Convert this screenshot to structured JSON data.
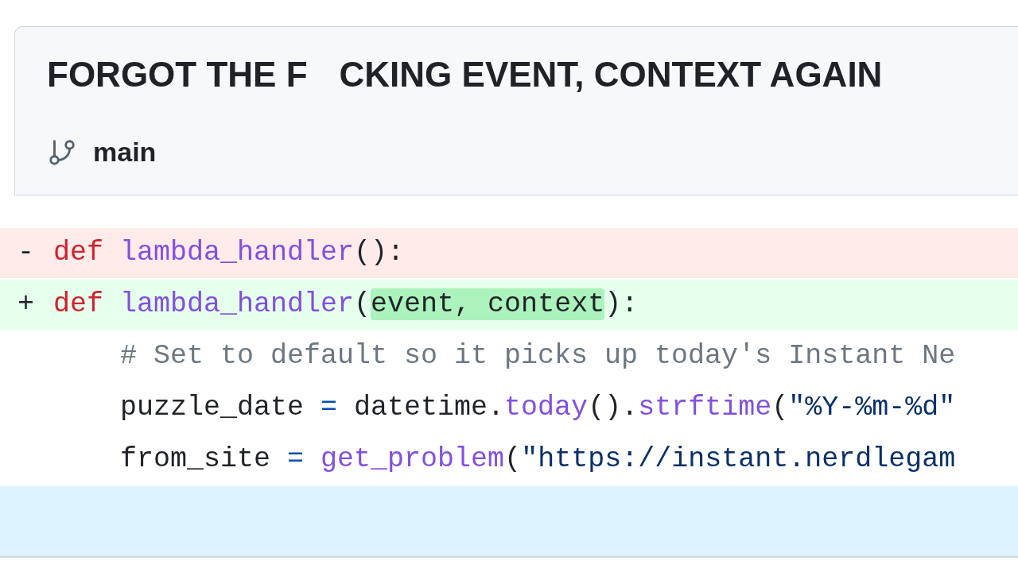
{
  "commit": {
    "title_parts": [
      "FORGOT THE F",
      "CKING EVENT, CONTEXT AGAIN"
    ],
    "branch": "main"
  },
  "diff": {
    "lines": [
      {
        "kind": "deleted",
        "prefix": "-",
        "tokens": [
          {
            "kind": "keyword",
            "text": "def"
          },
          {
            "kind": "function",
            "text": " lambda_handler"
          },
          {
            "kind": "plain",
            "text": "():"
          }
        ]
      },
      {
        "kind": "added",
        "prefix": "+",
        "tokens": [
          {
            "kind": "keyword",
            "text": "def"
          },
          {
            "kind": "function",
            "text": " lambda_handler"
          },
          {
            "kind": "plain",
            "text": "("
          },
          {
            "kind": "highlight",
            "text": "event, context"
          },
          {
            "kind": "plain",
            "text": "):"
          }
        ]
      },
      {
        "kind": "context",
        "tokens": [
          {
            "kind": "comment",
            "text": "# Set to default so it picks up today's Instant Ne"
          }
        ]
      },
      {
        "kind": "context",
        "tokens": [
          {
            "kind": "plain",
            "text": "puzzle_date "
          },
          {
            "kind": "operator",
            "text": "="
          },
          {
            "kind": "plain",
            "text": " datetime."
          },
          {
            "kind": "function",
            "text": "today"
          },
          {
            "kind": "plain",
            "text": "()."
          },
          {
            "kind": "function",
            "text": "strftime"
          },
          {
            "kind": "plain",
            "text": "("
          },
          {
            "kind": "string",
            "text": "\"%Y-%m-%d\""
          }
        ]
      },
      {
        "kind": "context",
        "tokens": [
          {
            "kind": "plain",
            "text": "from_site "
          },
          {
            "kind": "operator",
            "text": "= "
          },
          {
            "kind": "function",
            "text": "get_problem"
          },
          {
            "kind": "plain",
            "text": "("
          },
          {
            "kind": "string",
            "text": "\"https://instant.nerdlegam"
          }
        ]
      },
      {
        "kind": "hunk"
      }
    ]
  }
}
